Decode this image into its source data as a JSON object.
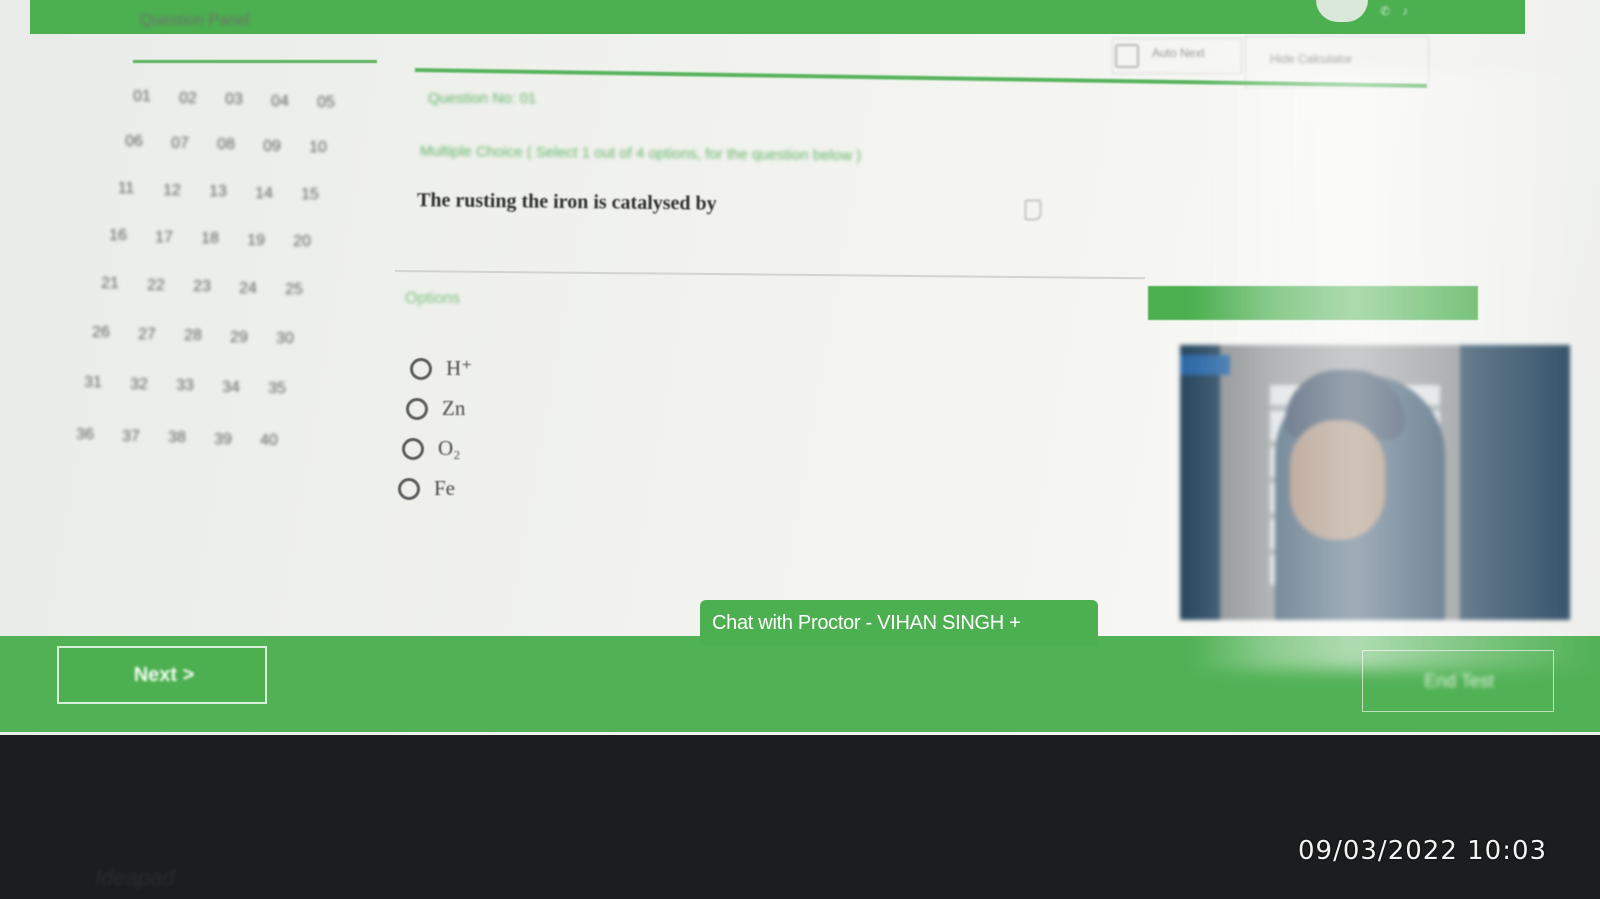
{
  "colors": {
    "accent": "#4caf50",
    "screen_bg": "#f1f2ee",
    "bezel": "#1c1d1e"
  },
  "header": {
    "user_text": "",
    "icons": [
      "phone-icon",
      "mic-icon"
    ]
  },
  "question_panel": {
    "title": "Question Panel",
    "numbers": [
      "01",
      "02",
      "03",
      "04",
      "05",
      "06",
      "07",
      "08",
      "09",
      "10",
      "11",
      "12",
      "13",
      "14",
      "15",
      "16",
      "17",
      "18",
      "19",
      "20",
      "21",
      "22",
      "23",
      "24",
      "25",
      "26",
      "27",
      "28",
      "29",
      "30",
      "31",
      "32",
      "33",
      "34",
      "35",
      "36",
      "37",
      "38",
      "39",
      "40"
    ]
  },
  "question": {
    "number_label": "Question No: 01",
    "instruction": "Multiple Choice ( Select 1 out of 4 options, for the question below )",
    "text": "The rusting the iron is catalysed by",
    "options_label": "Options",
    "options": [
      "H⁺",
      "Zn",
      "O₂",
      "Fe"
    ]
  },
  "controls": {
    "auto_next_label": "Auto Next",
    "hide_label": "Hide Calculator"
  },
  "footer": {
    "next_label": "Next >",
    "chat_label": "Chat with Proctor - VIHAN SINGH  +",
    "end_label": "End Test"
  },
  "photo": {
    "timestamp": "09/03/2022 10:03"
  }
}
